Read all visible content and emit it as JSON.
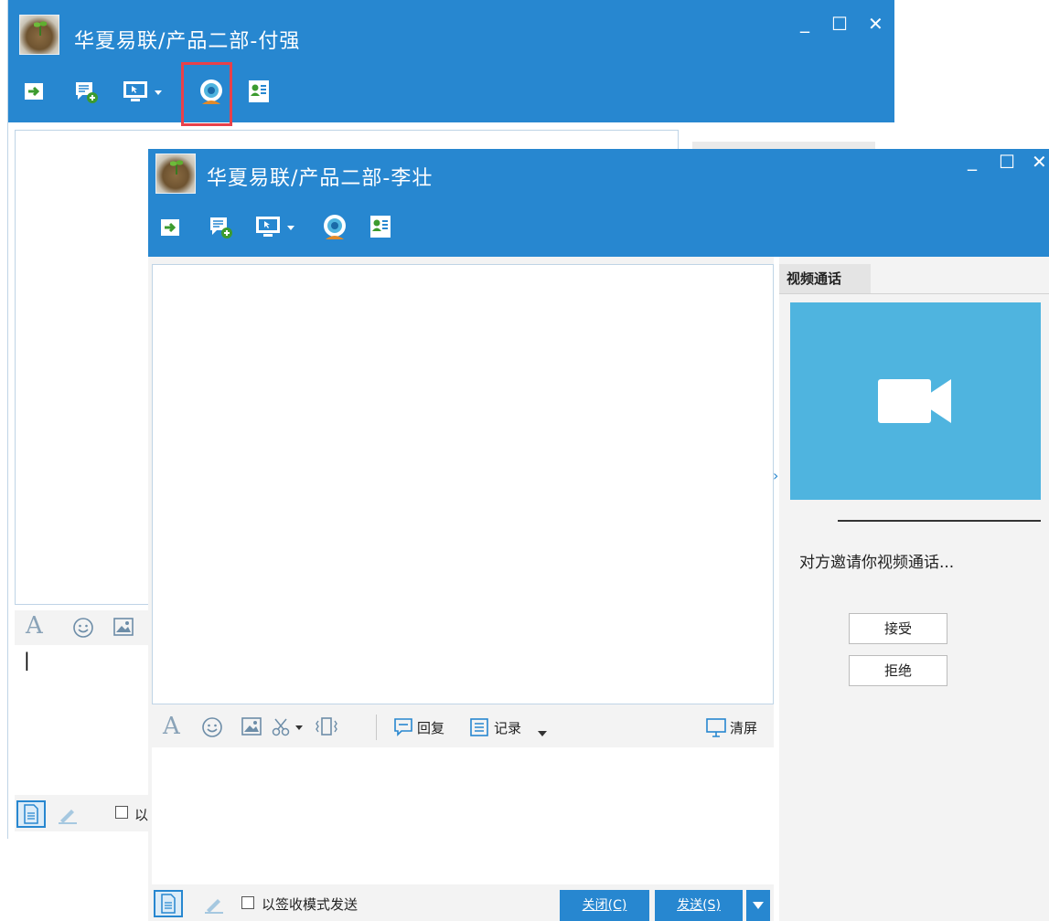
{
  "back_window": {
    "title": "华夏易联/产品二部-付强",
    "controls": {
      "minimize": "_",
      "maximize": "☐",
      "close": "✕"
    },
    "input_cursor": "|",
    "sign_mode_label_partial": "以"
  },
  "front_window": {
    "title": "华夏易联/产品二部-李壮",
    "controls": {
      "minimize": "_",
      "maximize": "☐",
      "close": "✕"
    },
    "side_tab": "视频通话",
    "invite_text": "对方邀请你视频通话...",
    "accept_button": "接受",
    "reject_button": "拒绝",
    "toolbar": {
      "font_icon": "A",
      "reply_label": "回复",
      "record_label": "记录",
      "clear_label": "清屏"
    },
    "sign_mode_label": "以签收模式发送",
    "close_button": "关闭(C)",
    "send_button": "发送(S)",
    "collapse_arrow": "›"
  },
  "colors": {
    "accent": "#2787d0",
    "video_tile": "#4fb4df",
    "highlight_box": "#e8414a"
  },
  "icons": [
    "transfer-file-icon",
    "add-message-icon",
    "remote-desktop-icon",
    "webcam-icon",
    "contact-card-icon"
  ]
}
